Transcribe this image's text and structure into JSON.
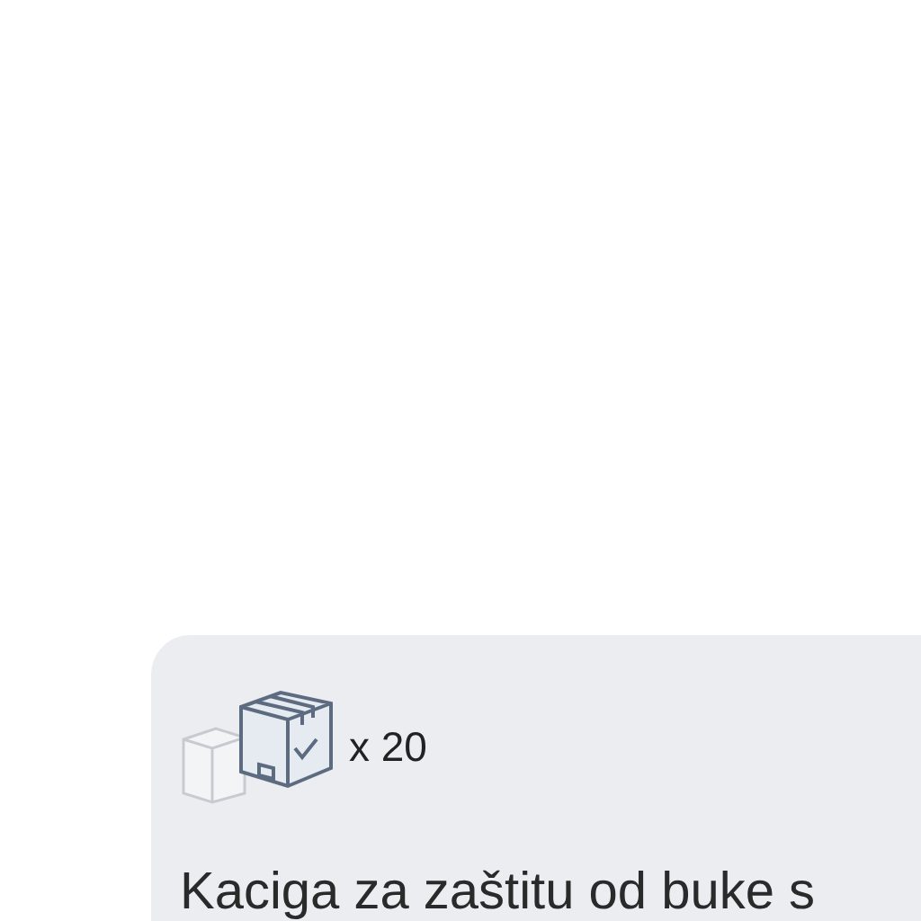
{
  "card": {
    "quantity": "x 20",
    "title": "Kaciga za zaštitu od buke s"
  }
}
